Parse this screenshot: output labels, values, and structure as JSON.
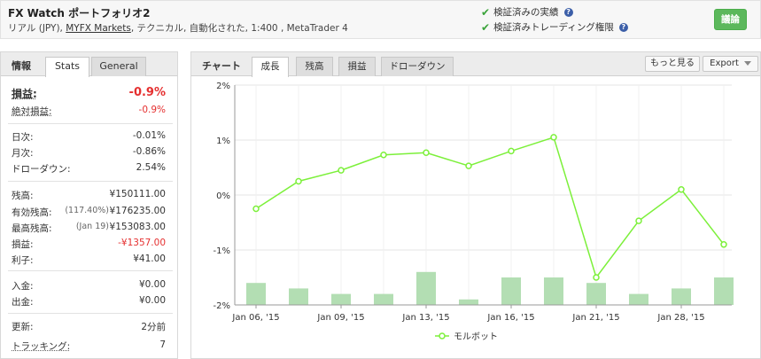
{
  "header": {
    "title": "FX Watch ポートフォリオ2",
    "subtitle_prefix": "リアル (JPY), ",
    "subtitle_link": "MYFX Markets",
    "subtitle_suffix": ", テクニカル, 自動化された, 1:400 , MetaTrader 4",
    "verify1": "検証済みの実績",
    "verify2": "検証済みトレーディング権限",
    "discuss_label": "議論"
  },
  "left_tabs": {
    "label": "情報",
    "stats": "Stats",
    "general": "General"
  },
  "stats": {
    "gain": {
      "label": "損益:",
      "value": "-0.9%"
    },
    "abs_gain": {
      "label": "絶対損益:",
      "value": "-0.9%"
    },
    "daily": {
      "label": "日次:",
      "value": "-0.01%"
    },
    "monthly": {
      "label": "月次:",
      "value": "-0.86%"
    },
    "drawdown": {
      "label": "ドローダウン:",
      "value": "2.54%"
    },
    "balance": {
      "label": "残高:",
      "value": "¥150111.00"
    },
    "equity": {
      "label": "有効残高:",
      "pct": "(117.40%)",
      "value": "¥176235.00"
    },
    "highest": {
      "label": "最高残高:",
      "pct": "(Jan 19)",
      "value": "¥153083.00"
    },
    "profit": {
      "label": "損益:",
      "value": "-¥1357.00"
    },
    "interest": {
      "label": "利子:",
      "value": "¥41.00"
    },
    "deposits": {
      "label": "入金:",
      "value": "¥0.00"
    },
    "withdrawals": {
      "label": "出金:",
      "value": "¥0.00"
    },
    "updated": {
      "label": "更新:",
      "value": "2分前"
    },
    "tracking": {
      "label": "トラッキング:",
      "value": "7"
    }
  },
  "chart_panel": {
    "label": "チャート",
    "tabs": [
      "成長",
      "残高",
      "損益",
      "ドローダウン"
    ],
    "more": "もっと見る",
    "export": "Export"
  },
  "chart_data": {
    "type": "line",
    "series": [
      {
        "name": "モルボット",
        "color": "#7cf03a",
        "values": [
          -0.25,
          0.25,
          0.45,
          0.73,
          0.77,
          0.53,
          0.8,
          1.05,
          -1.5,
          -0.47,
          0.1,
          -0.9
        ]
      }
    ],
    "bars": [
      -1.6,
      -1.7,
      -1.8,
      -1.8,
      -1.4,
      -1.9,
      -1.5,
      -1.5,
      -1.6,
      -1.8,
      -1.7,
      -1.5
    ],
    "bar_color": "#b3deb3",
    "y_ticks": [
      "2%",
      "1%",
      "0%",
      "-1%",
      "-2%"
    ],
    "ylim": [
      -2,
      2
    ],
    "x_tick_labels": [
      "Jan 06, '15",
      "Jan 09, '15",
      "Jan 13, '15",
      "Jan 16, '15",
      "Jan 21, '15",
      "Jan 28, '15"
    ],
    "x_tick_index": [
      0,
      2,
      4,
      6,
      8,
      10
    ],
    "legend": "モルボット",
    "grid": true
  }
}
